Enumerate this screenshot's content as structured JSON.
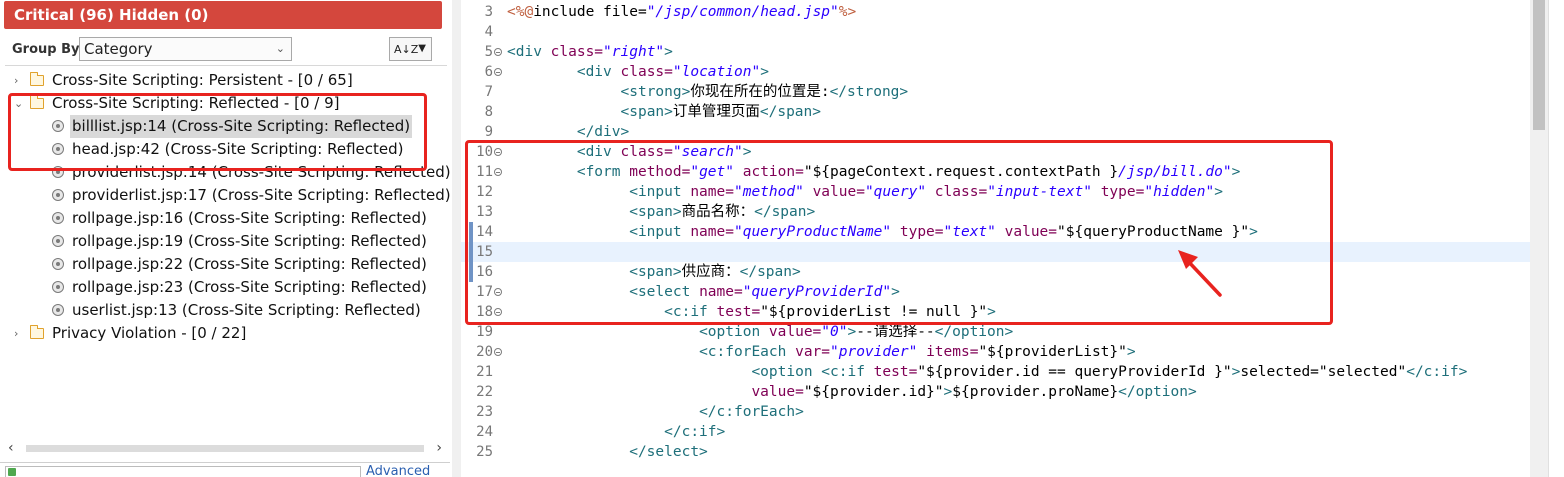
{
  "left": {
    "header": "Critical (96) Hidden (0)",
    "group_by_label": "Group By:",
    "group_by_value": "Category",
    "sort_icon": "AZ-sort-icon",
    "tree": [
      {
        "type": "folder",
        "expanded": false,
        "label": "Cross-Site Scripting: Persistent - [0 / 65]"
      },
      {
        "type": "folder",
        "expanded": true,
        "label": "Cross-Site Scripting: Reflected - [0 / 9]"
      },
      {
        "type": "issue",
        "selected": true,
        "label": "billlist.jsp:14 (Cross-Site Scripting: Reflected)"
      },
      {
        "type": "issue",
        "label": "head.jsp:42 (Cross-Site Scripting: Reflected)"
      },
      {
        "type": "issue",
        "label": "providerlist.jsp:14 (Cross-Site Scripting: Reflected)"
      },
      {
        "type": "issue",
        "label": "providerlist.jsp:17 (Cross-Site Scripting: Reflected)"
      },
      {
        "type": "issue",
        "label": "rollpage.jsp:16 (Cross-Site Scripting: Reflected)"
      },
      {
        "type": "issue",
        "label": "rollpage.jsp:19 (Cross-Site Scripting: Reflected)"
      },
      {
        "type": "issue",
        "label": "rollpage.jsp:22 (Cross-Site Scripting: Reflected)"
      },
      {
        "type": "issue",
        "label": "rollpage.jsp:23 (Cross-Site Scripting: Reflected)"
      },
      {
        "type": "issue",
        "label": "userlist.jsp:13 (Cross-Site Scripting: Reflected)"
      },
      {
        "type": "folder",
        "expanded": false,
        "label": "Privacy Violation - [0 / 22]"
      }
    ],
    "advanced_label": "Advanced"
  },
  "editor": {
    "lines": [
      {
        "n": "3",
        "fold": false,
        "mark": false,
        "segs": [
          [
            "jsp",
            "<%@"
          ],
          [
            "txt",
            "include "
          ],
          [
            "txt",
            "file="
          ],
          [
            "val",
            "\"/jsp/common/head.jsp\""
          ],
          [
            "jsp",
            "%>"
          ]
        ]
      },
      {
        "n": "4",
        "fold": false,
        "mark": false,
        "segs": []
      },
      {
        "n": "5",
        "fold": true,
        "mark": false,
        "segs": [
          [
            "tag",
            "<div "
          ],
          [
            "attr",
            "class="
          ],
          [
            "val",
            "\"right\""
          ],
          [
            "tag",
            ">"
          ]
        ]
      },
      {
        "n": "6",
        "fold": true,
        "mark": false,
        "segs": [
          [
            "txt",
            "        "
          ],
          [
            "tag",
            "<div "
          ],
          [
            "attr",
            "class="
          ],
          [
            "val",
            "\"location\""
          ],
          [
            "tag",
            ">"
          ]
        ]
      },
      {
        "n": "7",
        "fold": false,
        "mark": false,
        "segs": [
          [
            "txt",
            "             "
          ],
          [
            "tag",
            "<strong>"
          ],
          [
            "txt",
            "你现在所在的位置是:"
          ],
          [
            "tag",
            "</strong>"
          ]
        ]
      },
      {
        "n": "8",
        "fold": false,
        "mark": false,
        "segs": [
          [
            "txt",
            "             "
          ],
          [
            "tag",
            "<span>"
          ],
          [
            "txt",
            "订单管理页面"
          ],
          [
            "tag",
            "</span>"
          ]
        ]
      },
      {
        "n": "9",
        "fold": false,
        "mark": false,
        "segs": [
          [
            "txt",
            "        "
          ],
          [
            "tag",
            "</div>"
          ]
        ]
      },
      {
        "n": "10",
        "fold": true,
        "mark": false,
        "segs": [
          [
            "txt",
            "        "
          ],
          [
            "tag",
            "<div "
          ],
          [
            "attr",
            "class="
          ],
          [
            "val",
            "\"search\""
          ],
          [
            "tag",
            ">"
          ]
        ]
      },
      {
        "n": "11",
        "fold": true,
        "mark": false,
        "segs": [
          [
            "txt",
            "        "
          ],
          [
            "tag",
            "<form "
          ],
          [
            "attr",
            "method="
          ],
          [
            "val",
            "\"get\""
          ],
          [
            "txt",
            " "
          ],
          [
            "attr",
            "action="
          ],
          [
            "txt",
            "\"${pageContext.request.contextPath }"
          ],
          [
            "val",
            "/jsp/bill.do\""
          ],
          [
            "tag",
            ">"
          ]
        ]
      },
      {
        "n": "12",
        "fold": false,
        "mark": false,
        "segs": [
          [
            "txt",
            "              "
          ],
          [
            "tag",
            "<input "
          ],
          [
            "attr",
            "name="
          ],
          [
            "val",
            "\"method\""
          ],
          [
            "txt",
            " "
          ],
          [
            "attr",
            "value="
          ],
          [
            "val",
            "\"query\""
          ],
          [
            "txt",
            " "
          ],
          [
            "attr",
            "class="
          ],
          [
            "val",
            "\"input-text\""
          ],
          [
            "txt",
            " "
          ],
          [
            "attr",
            "type="
          ],
          [
            "val",
            "\"hidden\""
          ],
          [
            "tag",
            ">"
          ]
        ]
      },
      {
        "n": "13",
        "fold": false,
        "mark": false,
        "segs": [
          [
            "txt",
            "              "
          ],
          [
            "tag",
            "<span>"
          ],
          [
            "txt",
            "商品名称："
          ],
          [
            "tag",
            "</span>"
          ]
        ]
      },
      {
        "n": "14",
        "fold": false,
        "mark": true,
        "segs": [
          [
            "txt",
            "              "
          ],
          [
            "tag",
            "<input "
          ],
          [
            "attr",
            "name="
          ],
          [
            "val",
            "\"queryProductName\""
          ],
          [
            "txt",
            " "
          ],
          [
            "attr",
            "type="
          ],
          [
            "val",
            "\"text\""
          ],
          [
            "txt",
            " "
          ],
          [
            "attr",
            "value="
          ],
          [
            "txt",
            "\"${queryProductName }\""
          ],
          [
            "tag",
            ">"
          ]
        ]
      },
      {
        "n": "15",
        "fold": false,
        "mark": true,
        "cur": true,
        "segs": []
      },
      {
        "n": "16",
        "fold": false,
        "mark": true,
        "segs": [
          [
            "txt",
            "              "
          ],
          [
            "tag",
            "<span>"
          ],
          [
            "txt",
            "供应商："
          ],
          [
            "tag",
            "</span>"
          ]
        ]
      },
      {
        "n": "17",
        "fold": true,
        "mark": false,
        "segs": [
          [
            "txt",
            "              "
          ],
          [
            "tag",
            "<select "
          ],
          [
            "attr",
            "name="
          ],
          [
            "val",
            "\"queryProviderId\""
          ],
          [
            "tag",
            ">"
          ]
        ]
      },
      {
        "n": "18",
        "fold": true,
        "mark": false,
        "segs": [
          [
            "txt",
            "                  "
          ],
          [
            "tag",
            "<c:if "
          ],
          [
            "attr",
            "test="
          ],
          [
            "txt",
            "\"${providerList != null }\""
          ],
          [
            "tag",
            ">"
          ]
        ]
      },
      {
        "n": "19",
        "fold": false,
        "mark": false,
        "segs": [
          [
            "txt",
            "                      "
          ],
          [
            "tag",
            "<option "
          ],
          [
            "attr",
            "value="
          ],
          [
            "val",
            "\"0\""
          ],
          [
            "tag",
            ">"
          ],
          [
            "txt",
            "--请选择--"
          ],
          [
            "tag",
            "</option>"
          ]
        ]
      },
      {
        "n": "20",
        "fold": true,
        "mark": false,
        "segs": [
          [
            "txt",
            "                      "
          ],
          [
            "tag",
            "<c:forEach "
          ],
          [
            "attr",
            "var="
          ],
          [
            "val",
            "\"provider\""
          ],
          [
            "txt",
            " "
          ],
          [
            "attr",
            "items="
          ],
          [
            "txt",
            "\"${providerList}\""
          ],
          [
            "tag",
            ">"
          ]
        ]
      },
      {
        "n": "21",
        "fold": false,
        "mark": false,
        "segs": [
          [
            "txt",
            "                            "
          ],
          [
            "tag",
            "<option "
          ],
          [
            "tag",
            "<c:if "
          ],
          [
            "attr",
            "test="
          ],
          [
            "txt",
            "\"${provider.id == queryProviderId }\""
          ],
          [
            "tag",
            ">"
          ],
          [
            "txt",
            "selected=\"selected\""
          ],
          [
            "tag",
            "</c:if>"
          ]
        ]
      },
      {
        "n": "22",
        "fold": false,
        "mark": false,
        "segs": [
          [
            "txt",
            "                            "
          ],
          [
            "attr",
            "value="
          ],
          [
            "txt",
            "\"${provider.id}\""
          ],
          [
            "tag",
            ">"
          ],
          [
            "txt",
            "${provider.proName}"
          ],
          [
            "tag",
            "</option>"
          ]
        ]
      },
      {
        "n": "23",
        "fold": false,
        "mark": false,
        "segs": [
          [
            "txt",
            "                      "
          ],
          [
            "tag",
            "</c:forEach>"
          ]
        ]
      },
      {
        "n": "24",
        "fold": false,
        "mark": false,
        "segs": [
          [
            "txt",
            "                  "
          ],
          [
            "tag",
            "</c:if>"
          ]
        ]
      },
      {
        "n": "25",
        "fold": false,
        "mark": false,
        "segs": [
          [
            "txt",
            "              "
          ],
          [
            "tag",
            "</select>"
          ]
        ]
      }
    ]
  },
  "colors": {
    "header_bg": "#d4473d",
    "highlight_red": "#e8231f",
    "tag": "#1e6f7a",
    "attr": "#7f0055",
    "value": "#2a00ff",
    "jsp": "#bf5f3f"
  }
}
